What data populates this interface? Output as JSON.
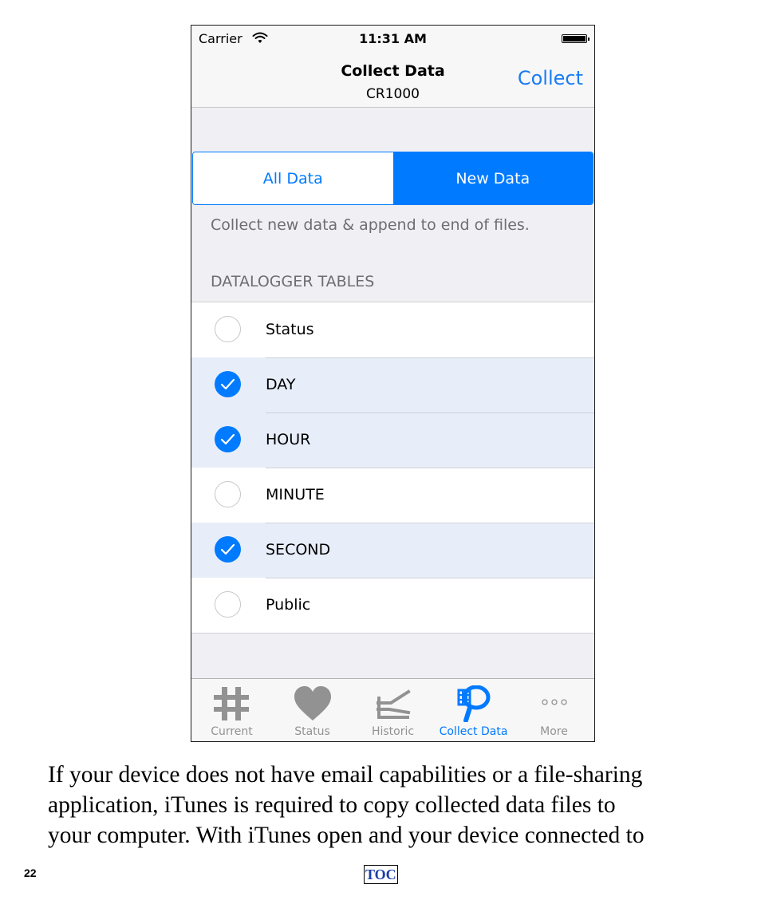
{
  "status_bar": {
    "carrier": "Carrier",
    "time": "11:31 AM"
  },
  "nav": {
    "title": "Collect Data",
    "subtitle": "CR1000",
    "action_label": "Collect"
  },
  "segmented": {
    "options": [
      "All Data",
      "New Data"
    ],
    "selected": "New Data"
  },
  "description": "Collect new data & append to end of files.",
  "section_header": "DATALOGGER TABLES",
  "tables": [
    {
      "label": "Status",
      "checked": false
    },
    {
      "label": "DAY",
      "checked": true
    },
    {
      "label": "HOUR",
      "checked": true
    },
    {
      "label": "MINUTE",
      "checked": false
    },
    {
      "label": "SECOND",
      "checked": true
    },
    {
      "label": "Public",
      "checked": false
    }
  ],
  "tabbar": {
    "items": [
      {
        "label": "Current",
        "icon": "hash-icon"
      },
      {
        "label": "Status",
        "icon": "heart-icon"
      },
      {
        "label": "Historic",
        "icon": "historic-icon"
      },
      {
        "label": "Collect Data",
        "icon": "collect-net-icon"
      },
      {
        "label": "More",
        "icon": "more-icon"
      }
    ],
    "active": "Collect Data"
  },
  "colors": {
    "accent": "#007aff",
    "selected_row": "#e7eef9",
    "inactive_tab": "#929292"
  },
  "document": {
    "paragraph_lines": [
      "If your device does not have email capabilities or a file-sharing",
      "application, iTunes is required to copy collected data files to",
      "your computer.  With iTunes open and your device connected to"
    ],
    "page_number": "22",
    "toc_label": "TOC"
  }
}
